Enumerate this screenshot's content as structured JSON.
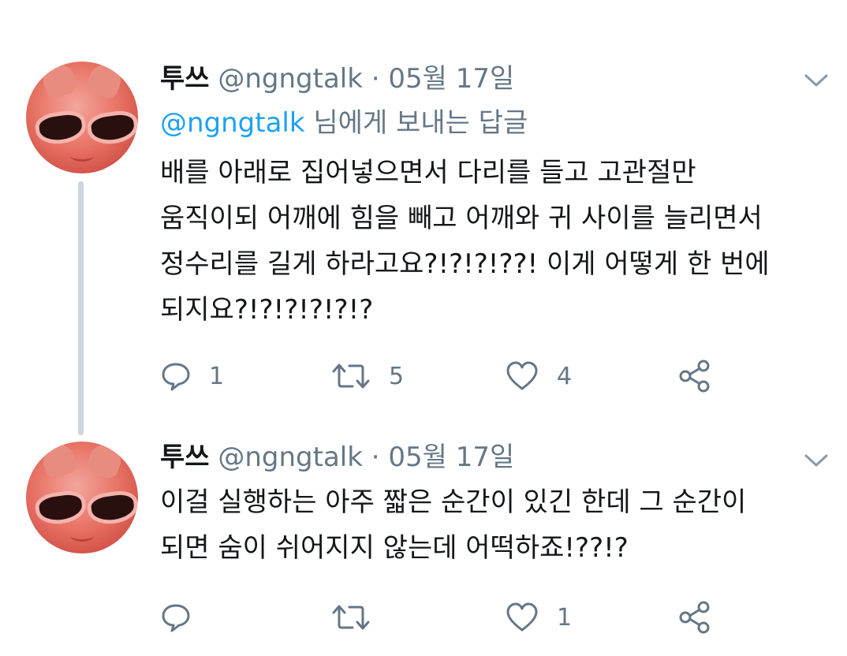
{
  "tweets": [
    {
      "name": "투쓰",
      "handle": "@ngngtalk",
      "separator": "·",
      "date": "05월 17일",
      "reply_to": {
        "handle": "@ngngtalk",
        "suffix": "님에게 보내는 답글"
      },
      "lines": [
        "배를 아래로 집어넣으면서 다리를 들고 고관절만",
        "움직이되 어깨에 힘을 빼고 어깨와 귀 사이를 늘리면서",
        "정수리를 길게 하라고요?!?!?!??! 이게 어떻게 한 번에",
        "되지요?!?!?!?!?!?"
      ],
      "counts": {
        "reply": "1",
        "retweet": "5",
        "like": "4"
      }
    },
    {
      "name": "투쓰",
      "handle": "@ngngtalk",
      "separator": "·",
      "date": "05월 17일",
      "lines": [
        "이걸 실행하는 아주 짧은 순간이 있긴 한데 그 순간이",
        "되면 숨이 쉬어지지 않는데 어떡하죠!??!?"
      ],
      "counts": {
        "reply": "",
        "retweet": "",
        "like": "1"
      }
    }
  ],
  "icons": {
    "reply": "speech-bubble-icon",
    "retweet": "retweet-icon",
    "like": "heart-icon",
    "share": "share-icon",
    "menu": "chevron-down-icon"
  },
  "colors": {
    "text": "#14171a",
    "muted": "#657786",
    "link": "#1da1f2",
    "thread_line": "#ccd6dd"
  }
}
